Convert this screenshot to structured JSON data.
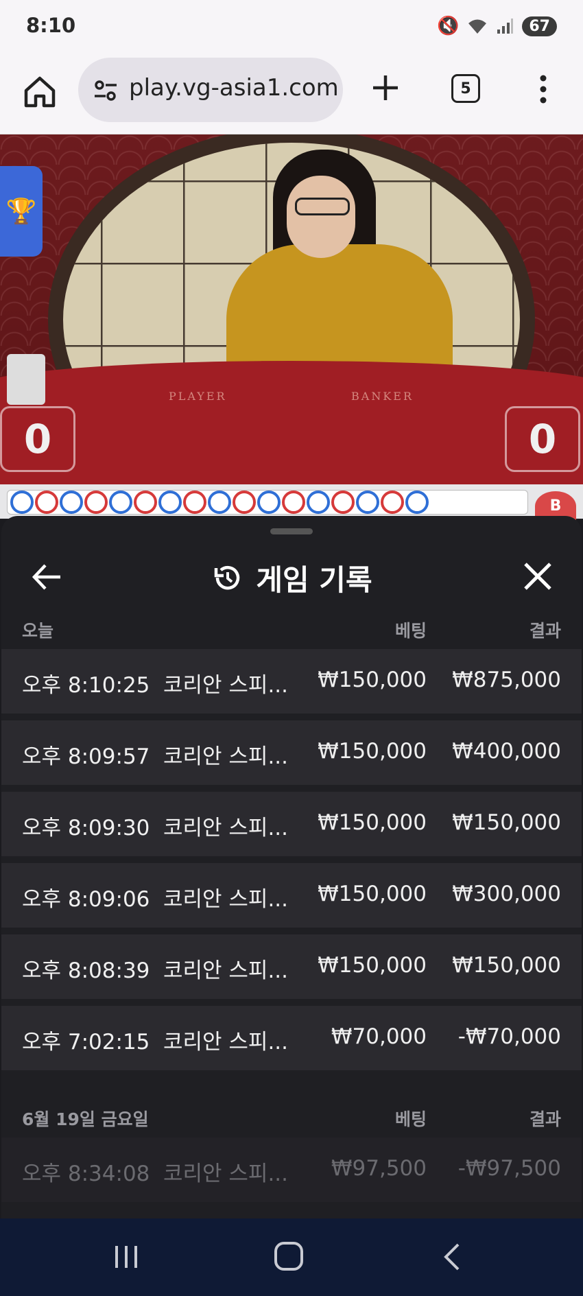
{
  "status_bar": {
    "time": "8:10",
    "battery": "67"
  },
  "browser": {
    "url": "play.vg-asia1.com",
    "tab_count": "5"
  },
  "video": {
    "player_label": "PLAYER",
    "banker_label": "BANKER",
    "player_score": "0",
    "banker_score": "0"
  },
  "road": {
    "beads": [
      "blue",
      "red",
      "blue",
      "red",
      "blue",
      "red",
      "blue",
      "red",
      "blue",
      "red",
      "blue",
      "red",
      "blue",
      "red",
      "blue",
      "red",
      "blue"
    ],
    "colors": {
      "blue": "#2f6fd6",
      "red": "#d63a3a"
    },
    "side_badge": "B"
  },
  "sheet": {
    "title": "게임 기록",
    "sections": [
      {
        "day": "오늘",
        "bet_header": "베팅",
        "result_header": "결과",
        "rows": [
          {
            "time": "오후 8:10:25",
            "game": "코리안 스피...",
            "bet": "₩150,000",
            "result": "₩875,000"
          },
          {
            "time": "오후 8:09:57",
            "game": "코리안 스피...",
            "bet": "₩150,000",
            "result": "₩400,000"
          },
          {
            "time": "오후 8:09:30",
            "game": "코리안 스피...",
            "bet": "₩150,000",
            "result": "₩150,000"
          },
          {
            "time": "오후 8:09:06",
            "game": "코리안 스피...",
            "bet": "₩150,000",
            "result": "₩300,000"
          },
          {
            "time": "오후 8:08:39",
            "game": "코리안 스피...",
            "bet": "₩150,000",
            "result": "₩150,000"
          },
          {
            "time": "오후 7:02:15",
            "game": "코리안 스피...",
            "bet": "₩70,000",
            "result": "-₩70,000"
          }
        ]
      },
      {
        "day": "6월 19일 금요일",
        "bet_header": "베팅",
        "result_header": "결과",
        "rows": [
          {
            "time": "오후 8:34:08",
            "game": "코리안 스피...",
            "bet": "₩97,500",
            "result": "-₩97,500"
          }
        ]
      }
    ]
  }
}
